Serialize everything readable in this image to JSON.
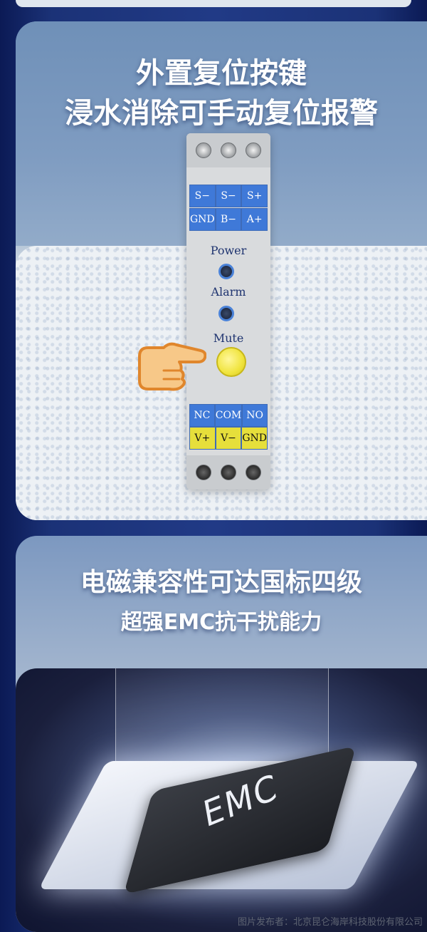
{
  "section1": {
    "title_line1": "外置复位按键",
    "title_line2": "浸水消除可手动复位报警"
  },
  "device": {
    "top_row1": [
      "S−",
      "S−",
      "S+"
    ],
    "top_row2": [
      "GND",
      "B−",
      "A+"
    ],
    "led_power": "Power",
    "led_alarm": "Alarm",
    "mute_label": "Mute",
    "bottom_row1": [
      "NC",
      "COM",
      "NO"
    ],
    "bottom_row2": [
      "V+",
      "V−",
      "GND"
    ]
  },
  "section2": {
    "title_line1": "电磁兼容性可达国标四级",
    "title_line2": "超强EMC抗干扰能力",
    "chip_text": "EMC"
  },
  "footer": {
    "credit": "图片发布者：北京昆仑海岸科技股份有限公司"
  },
  "colors": {
    "terminal_blue": "#3f79d8",
    "terminal_yellow": "#e6df3b",
    "mute_button": "#f0e43e"
  }
}
